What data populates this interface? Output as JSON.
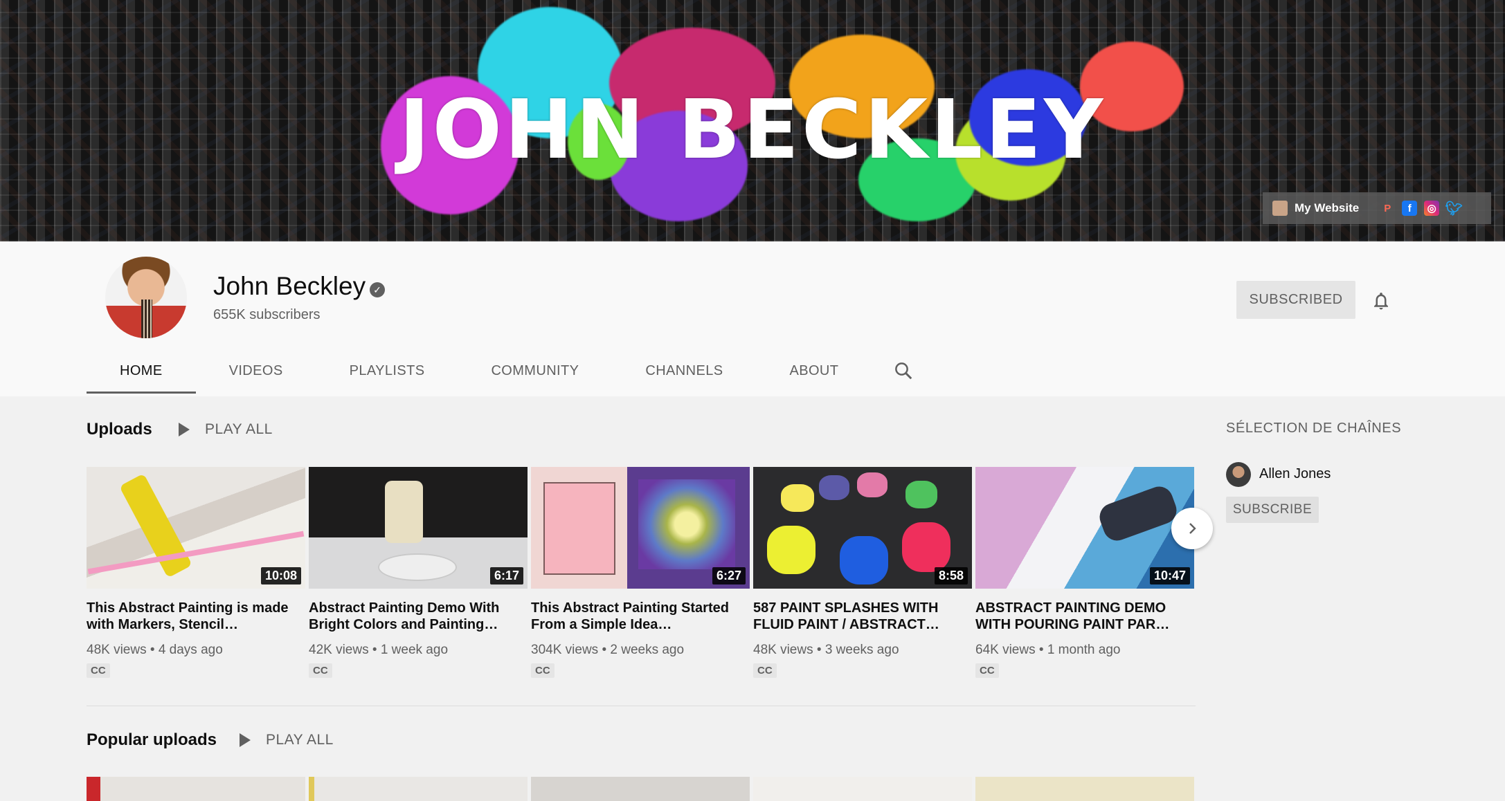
{
  "banner": {
    "title": "JOHN BECKLEY",
    "links": {
      "site_label": "My Website",
      "social": [
        "patreon-icon",
        "facebook-icon",
        "instagram-icon",
        "twitter-icon"
      ]
    }
  },
  "channel": {
    "name": "John Beckley",
    "subscribers": "655K subscribers",
    "subscribed_label": "SUBSCRIBED"
  },
  "tabs": [
    "HOME",
    "VIDEOS",
    "PLAYLISTS",
    "COMMUNITY",
    "CHANNELS",
    "ABOUT"
  ],
  "uploads": {
    "title": "Uploads",
    "play_all": "PLAY ALL",
    "videos": [
      {
        "title": "This Abstract Painting is made with Markers, Stencil…",
        "views": "48K views",
        "age": "4 days ago",
        "duration": "10:08",
        "cc": "CC"
      },
      {
        "title": "Abstract Painting Demo With Bright Colors and Painting…",
        "views": "42K views",
        "age": "1 week ago",
        "duration": "6:17",
        "cc": "CC"
      },
      {
        "title": "This Abstract Painting Started From a Simple Idea…",
        "views": "304K views",
        "age": "2 weeks ago",
        "duration": "6:27",
        "cc": "CC"
      },
      {
        "title": "587 PAINT SPLASHES WITH FLUID PAINT / ABSTRACT…",
        "views": "48K views",
        "age": "3 weeks ago",
        "duration": "8:58",
        "cc": "CC"
      },
      {
        "title": "ABSTRACT PAINTING DEMO WITH POURING PAINT PAR…",
        "views": "64K views",
        "age": "1 month ago",
        "duration": "10:47",
        "cc": "CC"
      }
    ],
    "meta_separator": "•"
  },
  "popular": {
    "title": "Popular uploads",
    "play_all": "PLAY ALL"
  },
  "sidebar": {
    "title": "SÉLECTION DE CHAÎNES",
    "channel_name": "Allen Jones",
    "subscribe_label": "SUBSCRIBE"
  },
  "colors": {
    "background": "#f9f9f9",
    "content_bg": "#f1f1f1",
    "text_secondary": "#606060"
  }
}
